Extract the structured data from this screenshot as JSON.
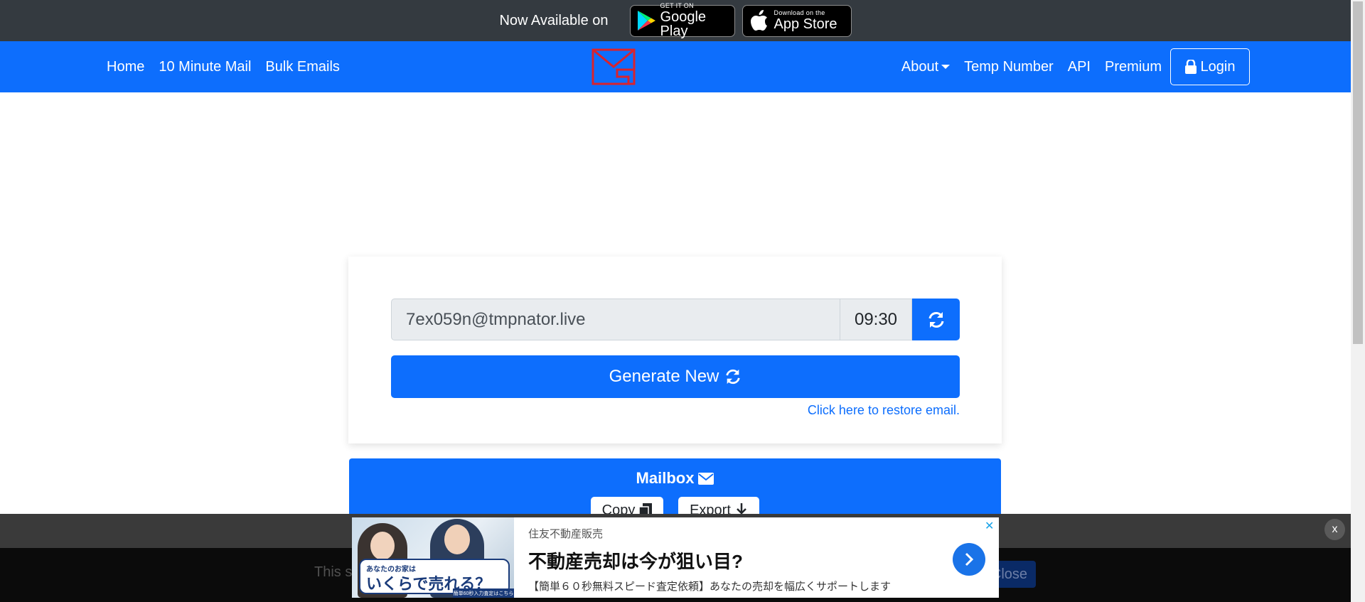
{
  "topbar": {
    "text": "Now Available on",
    "google_play": {
      "small": "GET IT ON",
      "big": "Google Play"
    },
    "app_store": {
      "small": "Download on the",
      "big": "App Store"
    }
  },
  "nav": {
    "left": [
      "Home",
      "10 Minute Mail",
      "Bulk Emails"
    ],
    "about": "About",
    "temp_number": "Temp Number",
    "api": "API",
    "premium": "Premium",
    "login": "Login"
  },
  "email_box": {
    "email": "7ex059n@tmpnator.live",
    "timer": "09:30",
    "generate_label": "Generate New",
    "restore_link": "Click here to restore email."
  },
  "mailbox": {
    "title": "Mailbox",
    "copy_label": "Copy",
    "export_label": "Export"
  },
  "cookie": {
    "text": "This si",
    "close_label": "Close",
    "dismiss_label": "x"
  },
  "ad": {
    "sponsor": "住友不動産販売",
    "headline": "不動産売却は今が狙い目?",
    "description": "【簡単６０秒無料スピード査定依頼】あなたの売却を幅広くサポートします",
    "image_caption_small": "あなたのお家は",
    "image_caption_big": "いくらで売れる？",
    "image_strip": "簡単60秒入力査定はこちら"
  },
  "colors": {
    "primary": "#0d6efd",
    "topbar": "#343a40",
    "logo_red": "#d9232d"
  }
}
